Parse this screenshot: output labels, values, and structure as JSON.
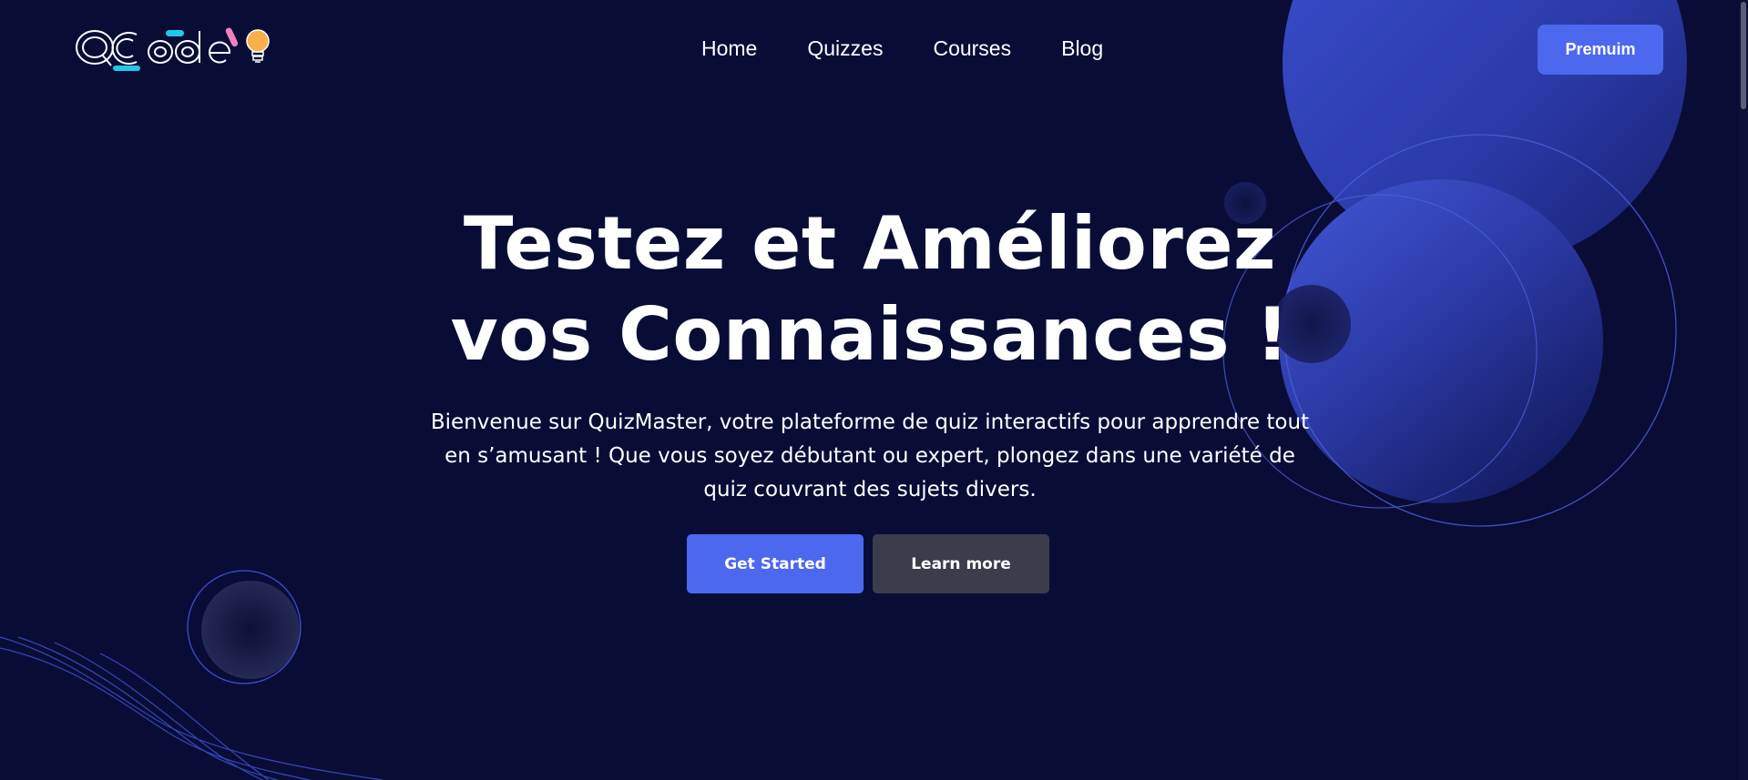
{
  "header": {
    "logo_text": "QCode",
    "nav": [
      "Home",
      "Quizzes",
      "Courses",
      "Blog"
    ],
    "premium_label": "Premuim"
  },
  "hero": {
    "title_line1": "Testez et Améliorez",
    "title_line2": "vos Connaissances !",
    "description": "Bienvenue sur QuizMaster, votre plateforme de quiz interactifs pour apprendre tout en s’amusant ! Que vous soyez débutant ou expert, plongez dans une variété de quiz couvrant des sujets divers.",
    "get_started_label": "Get Started",
    "learn_more_label": "Learn more"
  },
  "colors": {
    "background": "#090d36",
    "accent": "#4b68ee",
    "secondary_button": "#3b3d4d",
    "logo_cyan": "#22c7e8",
    "logo_pink": "#f27ec0",
    "logo_yellow": "#f7b04a"
  },
  "icons": {
    "logo_bulb": "lightbulb-icon"
  }
}
